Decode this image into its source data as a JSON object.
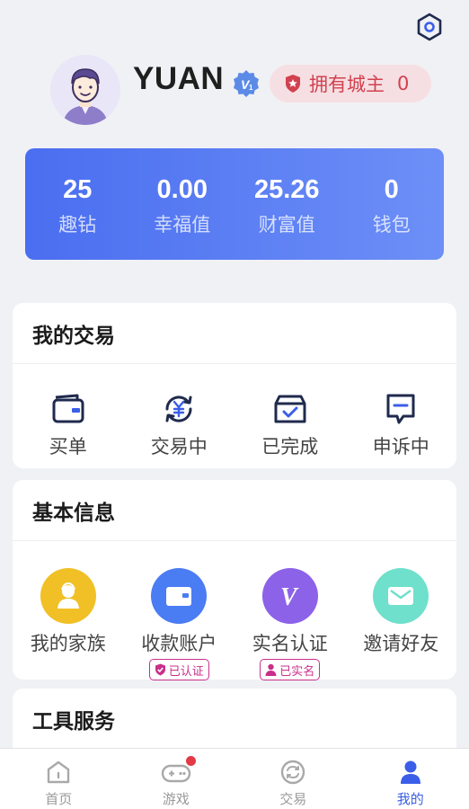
{
  "profile": {
    "username": "YUAN",
    "city_owner_label": "拥有城主",
    "city_owner_count": "0"
  },
  "stats": [
    {
      "value": "25",
      "label": "趣钻"
    },
    {
      "value": "0.00",
      "label": "幸福值"
    },
    {
      "value": "25.26",
      "label": "财富值"
    },
    {
      "value": "0",
      "label": "钱包"
    }
  ],
  "trade": {
    "title": "我的交易",
    "items": [
      {
        "label": "买单",
        "icon": "wallet-icon"
      },
      {
        "label": "交易中",
        "icon": "yuan-exchange-icon"
      },
      {
        "label": "已完成",
        "icon": "box-check-icon"
      },
      {
        "label": "申诉中",
        "icon": "chat-appeal-icon"
      }
    ]
  },
  "info": {
    "title": "基本信息",
    "items": [
      {
        "label": "我的家族",
        "icon": "family-icon",
        "color": "#f0c026"
      },
      {
        "label": "收款账户",
        "icon": "card-icon",
        "color": "#4a7cf3",
        "tag": "已认证"
      },
      {
        "label": "实名认证",
        "icon": "v-icon",
        "color": "#8b62e8",
        "tag": "已实名"
      },
      {
        "label": "邀请好友",
        "icon": "mail-icon",
        "color": "#6ee0cb"
      }
    ]
  },
  "tools": {
    "title": "工具服务"
  },
  "tabbar": [
    {
      "label": "首页",
      "icon": "home-icon"
    },
    {
      "label": "游戏",
      "icon": "gamepad-icon"
    },
    {
      "label": "交易",
      "icon": "exchange-icon"
    },
    {
      "label": "我的",
      "icon": "person-icon",
      "active": true
    }
  ],
  "colors": {
    "accent": "#3b5ee8",
    "badge_red": "#e23b45",
    "tag_magenta": "#c9308a"
  }
}
